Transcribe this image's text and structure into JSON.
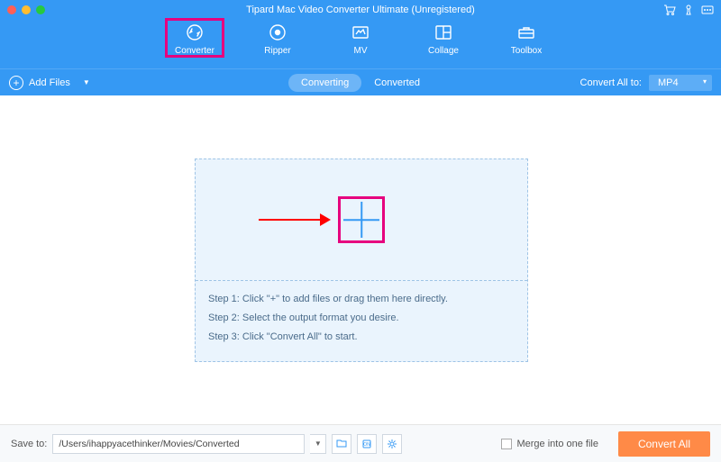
{
  "title": "Tipard Mac Video Converter Ultimate (Unregistered)",
  "nav": {
    "items": [
      {
        "label": "Converter"
      },
      {
        "label": "Ripper"
      },
      {
        "label": "MV"
      },
      {
        "label": "Collage"
      },
      {
        "label": "Toolbox"
      }
    ]
  },
  "toolbar": {
    "add_files": "Add Files",
    "tab_converting": "Converting",
    "tab_converted": "Converted",
    "convert_all_to": "Convert All to:",
    "format": "MP4"
  },
  "drop": {
    "step1": "Step 1: Click \"+\" to add files or drag them here directly.",
    "step2": "Step 2: Select the output format you desire.",
    "step3": "Step 3: Click \"Convert All\" to start."
  },
  "footer": {
    "save_to_label": "Save to:",
    "save_path": "/Users/ihappyacethinker/Movies/Converted",
    "merge_label": "Merge into one file",
    "convert_all": "Convert All"
  }
}
